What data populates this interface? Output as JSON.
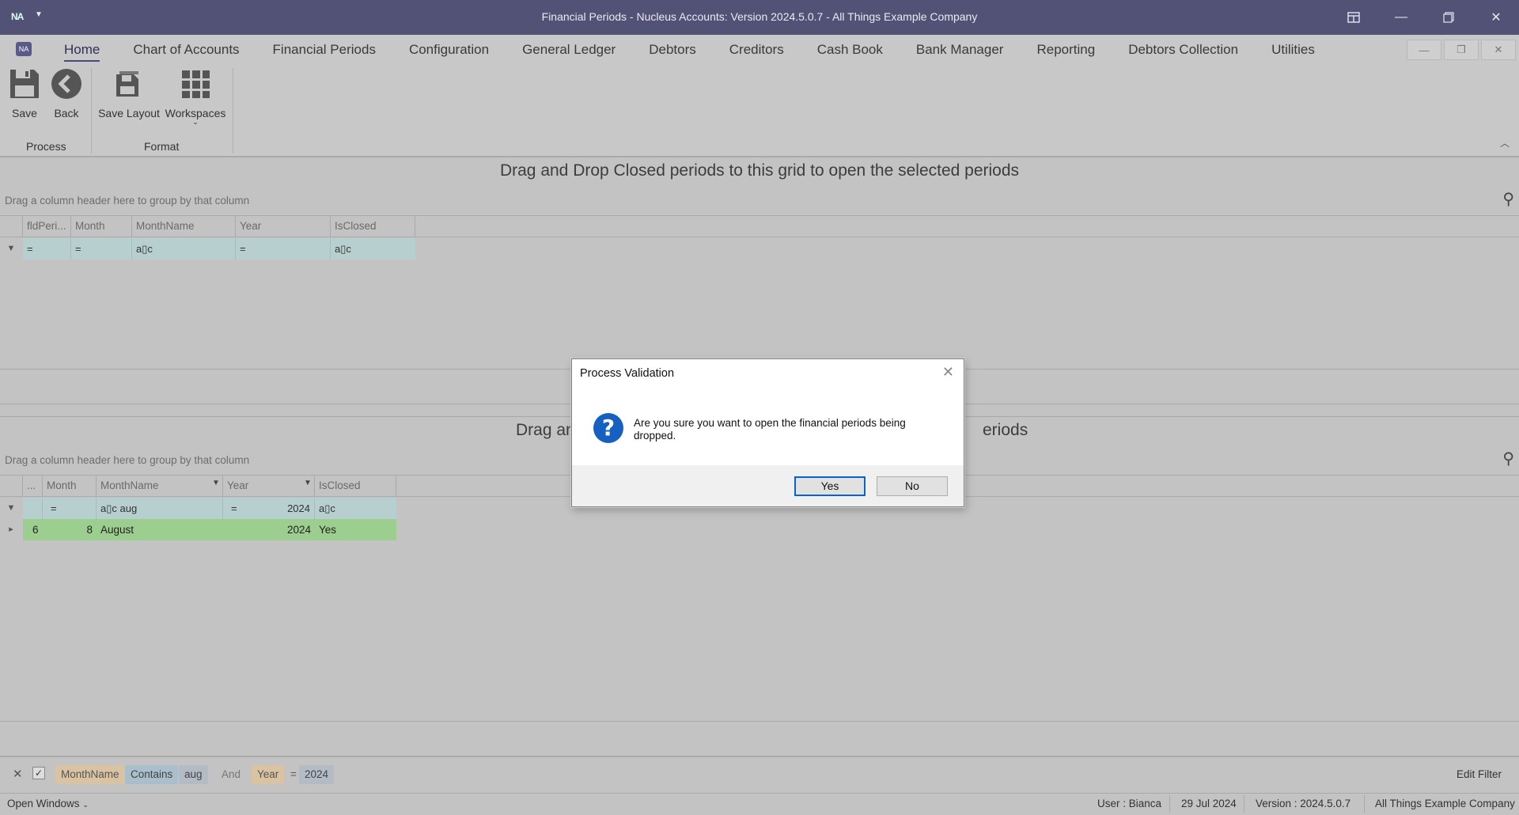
{
  "window": {
    "title": "Financial Periods - Nucleus Accounts: Version 2024.5.0.7 - All Things Example Company",
    "app_icon": "NA"
  },
  "ribbon": {
    "tabs": [
      "Home",
      "Chart of Accounts",
      "Financial Periods",
      "Configuration",
      "General Ledger",
      "Debtors",
      "Creditors",
      "Cash Book",
      "Bank Manager",
      "Reporting",
      "Debtors Collection",
      "Utilities"
    ],
    "active_tab": "Home",
    "buttons": {
      "save": "Save",
      "back": "Back",
      "save_layout": "Save Layout",
      "workspaces": "Workspaces"
    },
    "groups": {
      "process": "Process",
      "format": "Format"
    }
  },
  "top_grid": {
    "caption": "Drag and Drop Closed periods to this grid to open the selected periods",
    "group_hint": "Drag a column header here to group by that column",
    "columns": [
      "fldPeri...",
      "Month",
      "MonthName",
      "Year",
      "IsClosed"
    ],
    "filter_row": [
      "=",
      "=",
      "a▯c",
      "=",
      "a▯c"
    ]
  },
  "bottom_grid": {
    "caption_left": "Drag an",
    "caption_right": "eriods",
    "group_hint": "Drag a column header here to group by that column",
    "columns": [
      "...",
      "Month",
      "MonthName",
      "Year",
      "IsClosed"
    ],
    "filter_row": {
      "month": "=",
      "monthname_op": "a▯c",
      "monthname": "aug",
      "year_op": "=",
      "year": "2024",
      "isclosed": "a▯c"
    },
    "rows": [
      {
        "id": "6",
        "month": "8",
        "monthname": "August",
        "year": "2024",
        "isclosed": "Yes"
      }
    ]
  },
  "filter_bar": {
    "field1": "MonthName",
    "op1": "Contains",
    "value1": "aug",
    "conjunction": "And",
    "field2": "Year",
    "op2": "=",
    "value2": "2024",
    "edit_filter": "Edit Filter"
  },
  "status_bar": {
    "open_windows": "Open Windows",
    "user": "User : Bianca",
    "date": "29 Jul 2024",
    "version": "Version : 2024.5.0.7",
    "company": "All Things Example Company"
  },
  "dialog": {
    "title": "Process Validation",
    "message": "Are you sure you want to open the financial periods being dropped.",
    "yes": "Yes",
    "no": "No"
  },
  "colors": {
    "titlebar": "#525276",
    "filter_row": "#b7cfcf",
    "selected_row": "#9ccf8f",
    "dialog_accent": "#0a64c8"
  }
}
